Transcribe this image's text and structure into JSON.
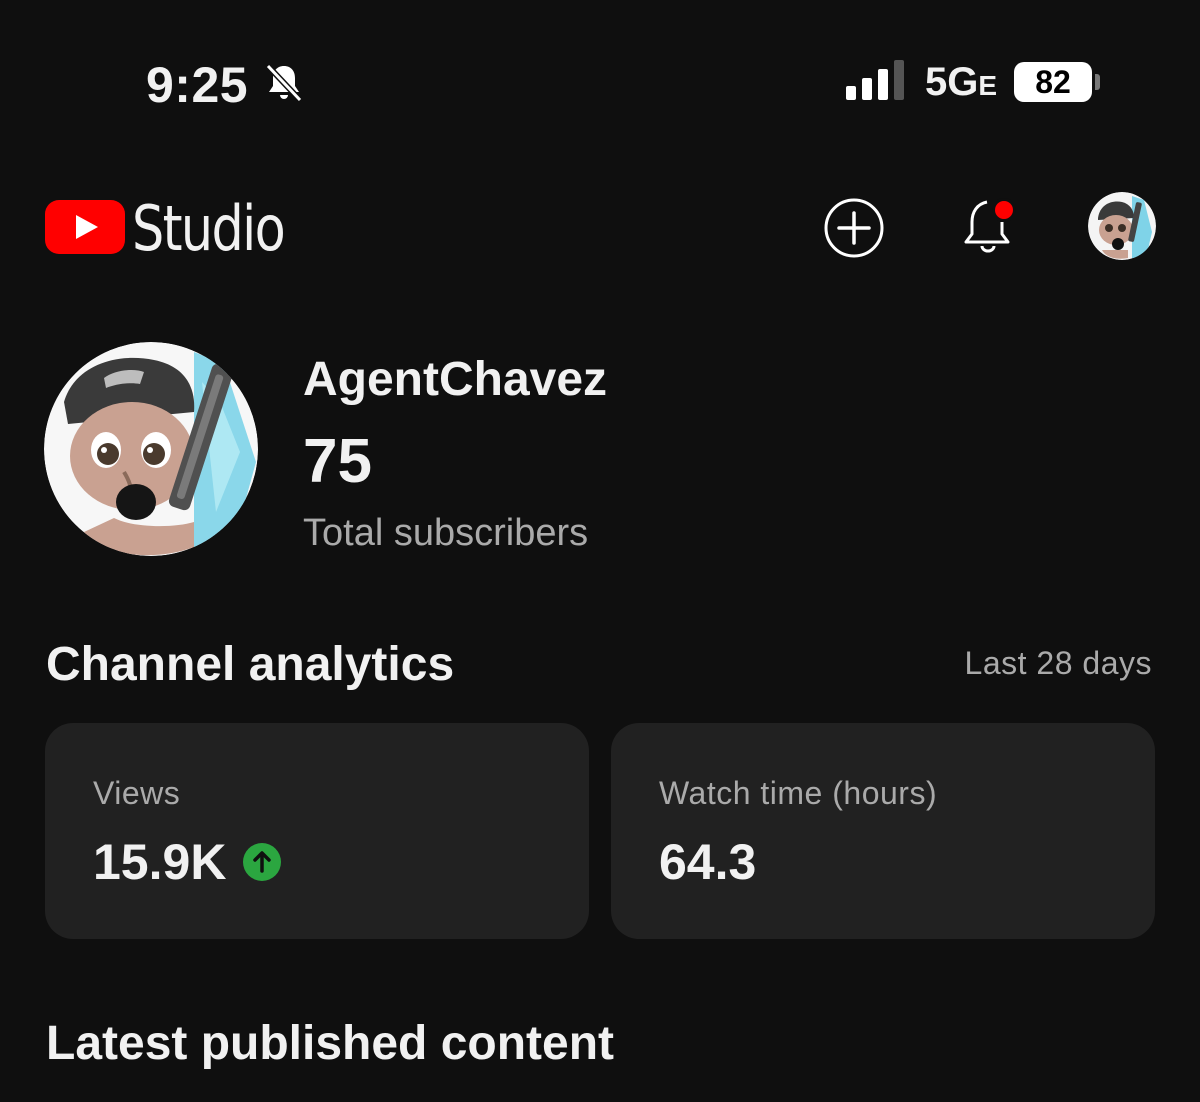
{
  "status_bar": {
    "time": "9:25",
    "network": "5G",
    "network_suffix": "E",
    "battery": "82"
  },
  "header": {
    "app_name": "Studio"
  },
  "channel": {
    "name": "AgentChavez",
    "subscribers": "75",
    "subscribers_label": "Total subscribers"
  },
  "analytics": {
    "title": "Channel analytics",
    "range": "Last 28 days",
    "cards": [
      {
        "label": "Views",
        "value": "15.9K",
        "trend": "up"
      },
      {
        "label": "Watch time (hours)",
        "value": "64.3"
      }
    ]
  },
  "latest": {
    "title": "Latest published content"
  },
  "colors": {
    "background": "#0f0f0f",
    "card": "#212121",
    "youtube_red": "#ff0000",
    "trend_green": "#2ba640",
    "muted_text": "#aaaaaa"
  },
  "icons": [
    "bell-off-icon",
    "signal-icon",
    "battery-icon",
    "youtube-logo-icon",
    "plus-circle-icon",
    "bell-icon",
    "arrow-up-icon"
  ]
}
